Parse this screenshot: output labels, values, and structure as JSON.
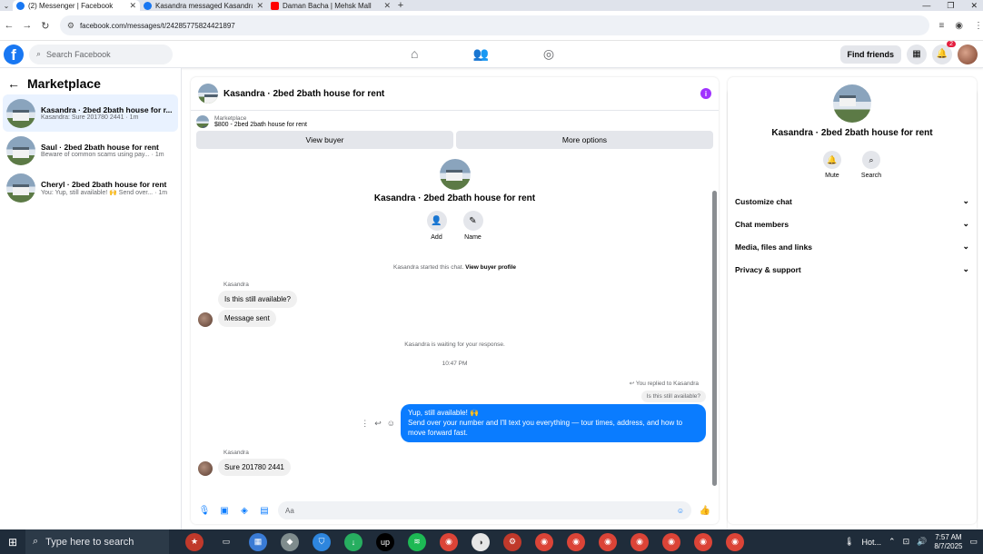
{
  "browser": {
    "tabs": [
      {
        "title": "(2) Messenger | Facebook",
        "icon": "facebook-icon",
        "active": true
      },
      {
        "title": "Kasandra messaged Kasandra",
        "icon": "facebook-icon",
        "active": false
      },
      {
        "title": "Daman Bacha | Mehsk Mall",
        "icon": "youtube-icon",
        "active": false
      }
    ],
    "url": "facebook.com/messages/t/24285775824421897"
  },
  "fb": {
    "search_placeholder": "Search Facebook",
    "find_friends": "Find friends",
    "notif_count": "2"
  },
  "sidebar": {
    "title": "Marketplace",
    "conversations": [
      {
        "name": "Kasandra · 2bed 2bath house for r...",
        "snippet": "Kasandra: Sure 201780 2441 · 1m"
      },
      {
        "name": "Saul · 2bed 2bath house for rent",
        "snippet": "Beware of common scams using pay... · 1m"
      },
      {
        "name": "Cheryl · 2bed 2bath house for rent",
        "snippet": "You: Yup, still available! 🙌 Send over... · 1m"
      }
    ]
  },
  "chat": {
    "title": "Kasandra · 2bed 2bath house for rent",
    "marketplace_label": "Marketplace",
    "listing": "$800 - 2bed 2bath house for rent",
    "view_buyer": "View buyer",
    "more_options": "More options",
    "thread_title": "Kasandra · 2bed 2bath house for rent",
    "add_label": "Add",
    "name_label": "Name",
    "started_text": "Kasandra started this chat.",
    "view_buyer_profile": "View buyer profile",
    "sender_name": "Kasandra",
    "msg1": "Is this still available?",
    "msg2": "Message sent",
    "waiting": "Kasandra is waiting for your response.",
    "time": "10:47 PM",
    "replied_note": "You replied to Kasandra",
    "quoted": "Is this still available?",
    "out_line1": "Yup, still available! 🙌",
    "out_line2": "Send over your number and I'll text you everything — tour times, address, and how to move forward fast.",
    "sender_name2": "Kasandra",
    "msg3": "Sure 201780 2441",
    "composer_placeholder": "Aa"
  },
  "details": {
    "title": "Kasandra · 2bed 2bath house for rent",
    "mute": "Mute",
    "search": "Search",
    "sections": [
      "Customize chat",
      "Chat members",
      "Media, files and links",
      "Privacy & support"
    ]
  },
  "taskbar": {
    "search_placeholder": "Type here to search",
    "weather": "Hot...",
    "time": "7:57 AM",
    "date": "8/7/2025"
  }
}
